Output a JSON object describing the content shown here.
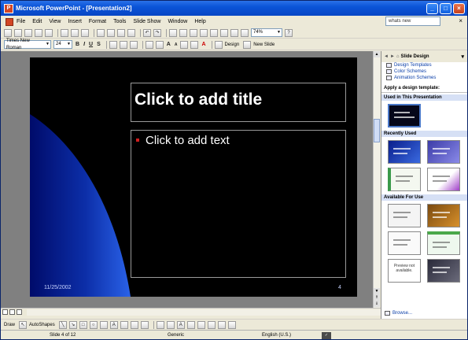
{
  "window": {
    "title": "Microsoft PowerPoint - [Presentation2]",
    "app_icon": "powerpoint-icon",
    "controls": [
      "minimize-icon",
      "maximize-icon",
      "close-icon"
    ]
  },
  "menu": {
    "items": [
      "File",
      "Edit",
      "View",
      "Insert",
      "Format",
      "Tools",
      "Slide Show",
      "Window",
      "Help"
    ],
    "help_box_text": "whats new"
  },
  "formatting": {
    "font_name": "Times New Roman",
    "font_size": "24",
    "design_label": "Design",
    "new_slide_label": "New Slide"
  },
  "standard": {
    "zoom": "74%"
  },
  "slide": {
    "title_placeholder": "Click to add title",
    "body_placeholder": "Click to add text",
    "date": "11/25/2002",
    "slide_number": "4",
    "bullet_color": "#d22020",
    "background_color": "#000000"
  },
  "task_pane": {
    "title": "Slide Design",
    "links": [
      "Design Templates",
      "Color Schemes",
      "Animation Schemes"
    ],
    "apply_label": "Apply a design template:",
    "sections": [
      {
        "label": "Used in This Presentation"
      },
      {
        "label": "Recently Used"
      },
      {
        "label": "Available For Use"
      }
    ],
    "preview_unavailable": "Preview not available.",
    "browse": "Browse..."
  },
  "drawing": {
    "draw_label": "Draw",
    "autoshapes_label": "AutoShapes"
  },
  "status": {
    "slide_info": "Slide 4 of 12",
    "design": "Generic",
    "language": "English (U.S.)"
  }
}
